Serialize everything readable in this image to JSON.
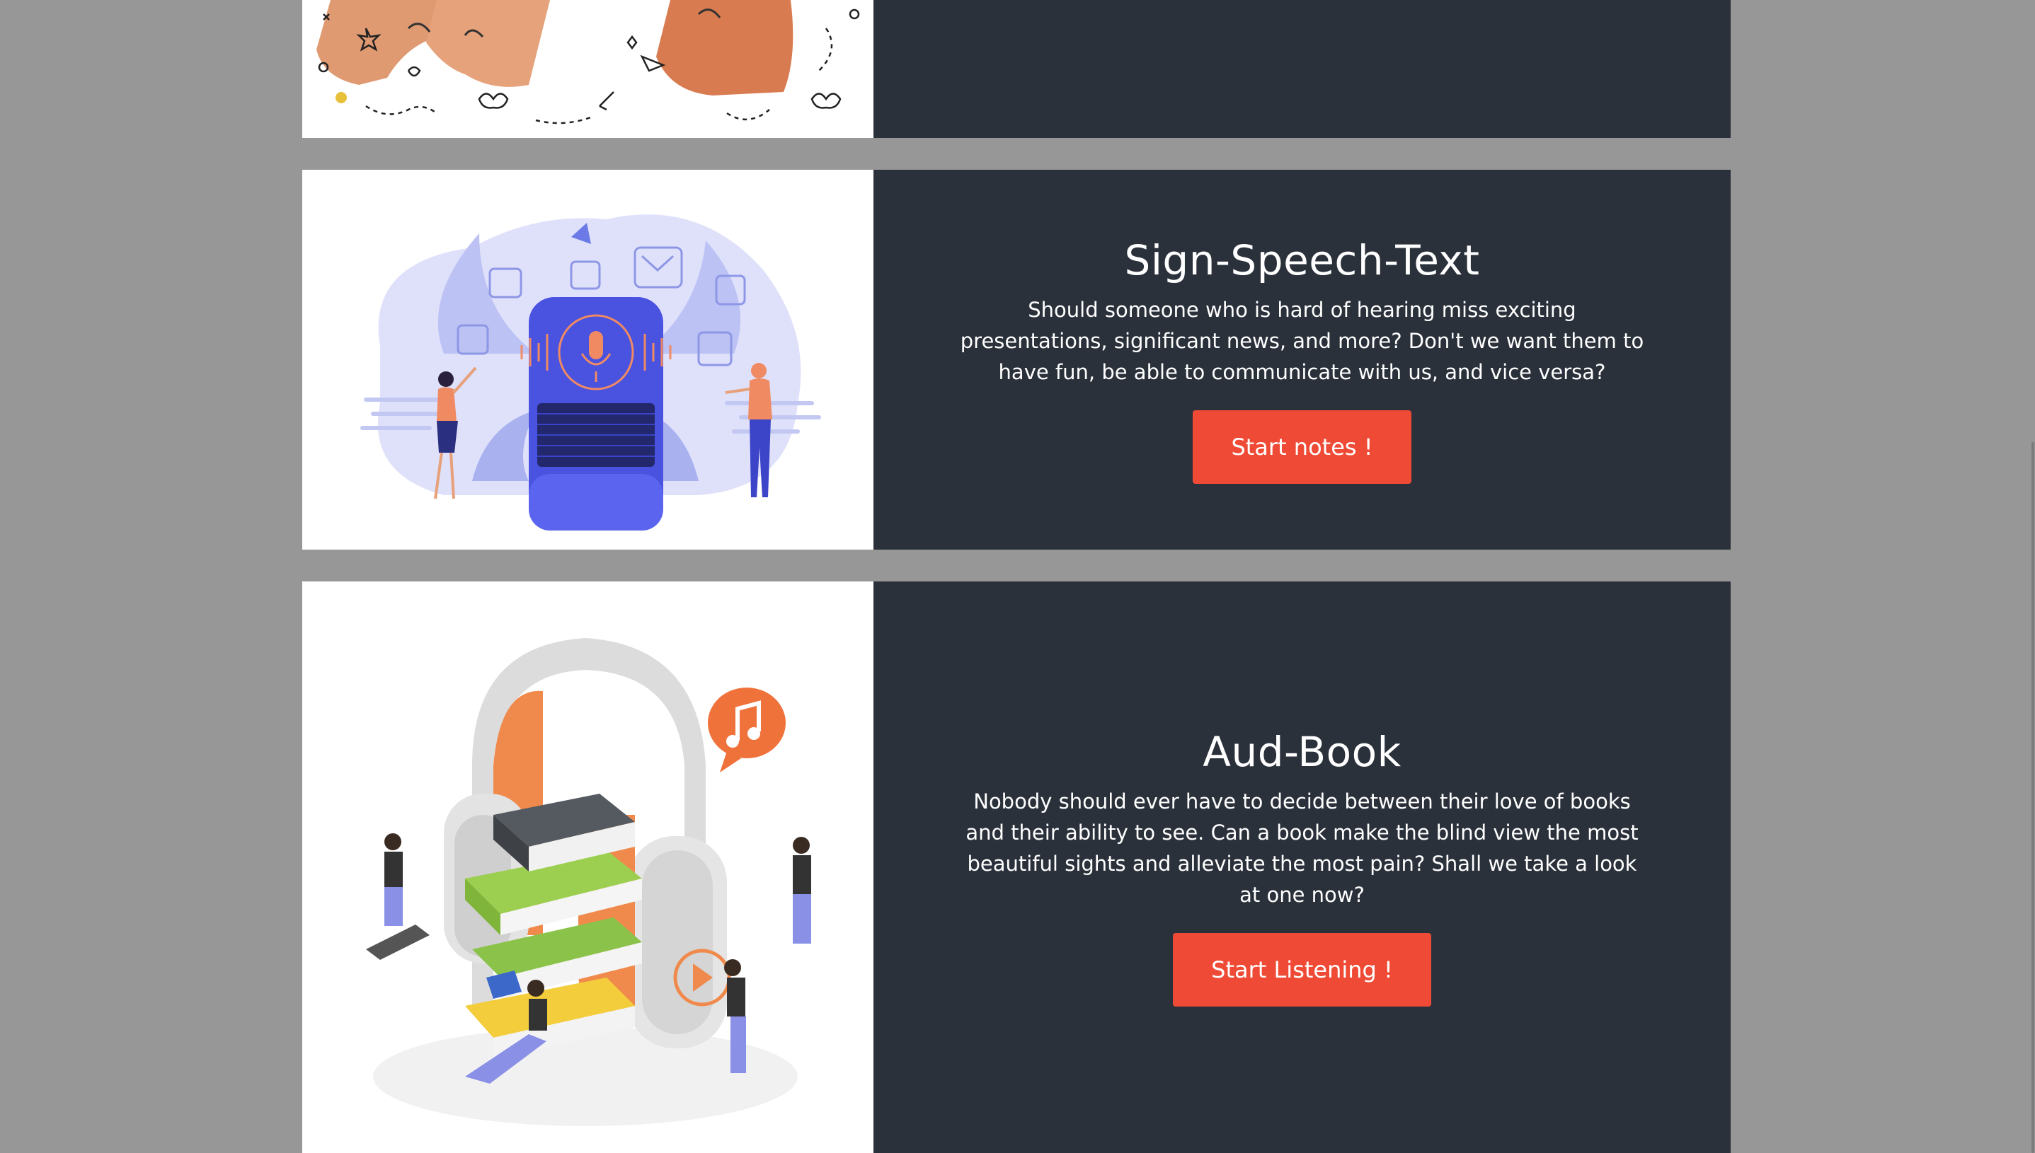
{
  "colors": {
    "page_background": "#979797",
    "card_background": "#2b313b",
    "button": "#ef4a35",
    "text": "#ffffff"
  },
  "cards": [
    {
      "image": "hands-heart-illustration"
    },
    {
      "title": "Sign-Speech-Text",
      "description": "Should someone who is hard of hearing miss exciting presentations, significant news, and more? Don't we want them to have fun, be able to communicate with us, and vice versa?",
      "button_label": "Start notes !",
      "image": "smart-speaker-illustration"
    },
    {
      "title": "Aud-Book",
      "description": "Nobody should ever have to decide between their love of books and their ability to see. Can a book make the blind view the most beautiful sights and alleviate the most pain? Shall we take a look at one now?",
      "button_label": "Start Listening !",
      "image": "headphones-books-illustration"
    }
  ]
}
